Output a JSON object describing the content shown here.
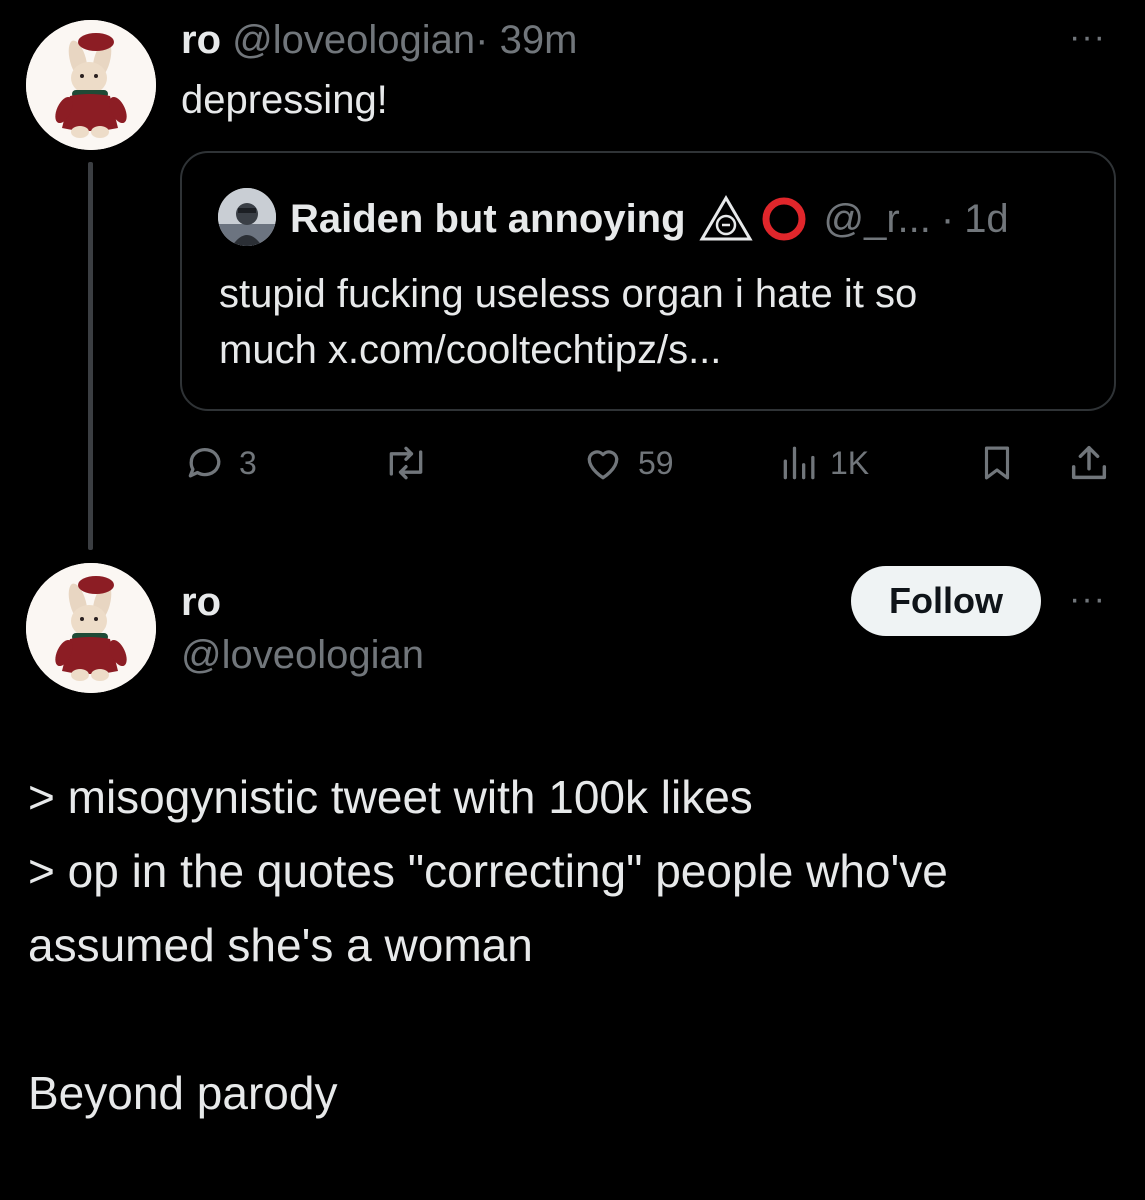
{
  "post1": {
    "author_name": "ro",
    "author_handle": "@loveologian",
    "separator": "·",
    "time": "39m",
    "text": "depressing!",
    "more_label": "···",
    "avatar_icon": "plush-bunny-avatar"
  },
  "quote": {
    "author_name": "Raiden but annoying",
    "emoji_1": "triangle-symbol",
    "emoji_2": "red-circle",
    "author_handle": "@_r...",
    "separator": "·",
    "time": "1d",
    "text_line1": "stupid fucking useless organ i hate it so",
    "text_line2": "much x.com/cooltechtipz/s..."
  },
  "actions": {
    "replies": "3",
    "reposts": "",
    "likes": "59",
    "views": "1K"
  },
  "post2": {
    "author_name": "ro",
    "author_handle": "@loveologian",
    "follow_label": "Follow",
    "more_label": "···",
    "body_lines": [
      "> misogynistic tweet with 100k likes",
      "> op in the quotes \"correcting\" people who've",
      "assumed she's a woman",
      "Beyond parody"
    ]
  },
  "colors": {
    "background": "#000000",
    "text": "#e7e9ea",
    "muted": "#71767b",
    "border": "#2f3336",
    "follow_bg": "#eff3f4"
  }
}
